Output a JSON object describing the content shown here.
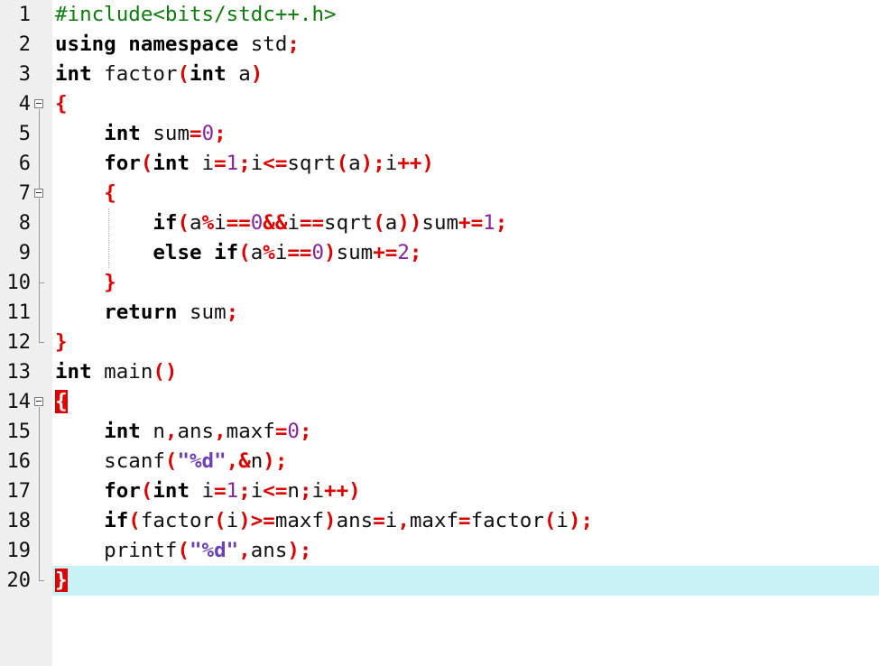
{
  "editor": {
    "current_line": 20,
    "lines": [
      {
        "n": "1"
      },
      {
        "n": "2"
      },
      {
        "n": "3"
      },
      {
        "n": "4"
      },
      {
        "n": "5"
      },
      {
        "n": "6"
      },
      {
        "n": "7"
      },
      {
        "n": "8"
      },
      {
        "n": "9"
      },
      {
        "n": "10"
      },
      {
        "n": "11"
      },
      {
        "n": "12"
      },
      {
        "n": "13"
      },
      {
        "n": "14"
      },
      {
        "n": "15"
      },
      {
        "n": "16"
      },
      {
        "n": "17"
      },
      {
        "n": "18"
      },
      {
        "n": "19"
      },
      {
        "n": "20"
      }
    ],
    "tokens": {
      "l1": {
        "a": "#include<bits/stdc++.h>"
      },
      "l2": {
        "a": "using",
        "b": " ",
        "c": "namespace",
        "d": " std",
        "e": ";"
      },
      "l3": {
        "a": "int",
        "b": " factor",
        "c": "(",
        "d": "int",
        "e": " a",
        "f": ")"
      },
      "l4": {
        "a": "{"
      },
      "l5": {
        "a": "    ",
        "b": "int",
        "c": " sum",
        "d": "=",
        "e": "0",
        "f": ";"
      },
      "l6": {
        "a": "    ",
        "b": "for",
        "c": "(",
        "d": "int",
        "e": " i",
        "f": "=",
        "g": "1",
        "h": ";",
        "i": "i",
        "j": "<=",
        "k": "sqrt",
        "l": "(",
        "m": "a",
        "n": ");",
        "o": "i",
        "p": "++",
        "q": ")"
      },
      "l7": {
        "a": "    ",
        "b": "{"
      },
      "l8": {
        "a": "        ",
        "b": "if",
        "c": "(",
        "d": "a",
        "e": "%",
        "f": "i",
        "g": "==",
        "h": "0",
        "i": "&&",
        "j": "i",
        "k": "==",
        "l": "sqrt",
        "m": "(",
        "n": "a",
        "o": "))",
        "p": "sum",
        "q": "+=",
        "r": "1",
        "s": ";"
      },
      "l9": {
        "a": "        ",
        "b": "else",
        "c": " ",
        "d": "if",
        "e": "(",
        "f": "a",
        "g": "%",
        "h": "i",
        "i": "==",
        "j": "0",
        "k": ")",
        "l": "sum",
        "m": "+=",
        "n": "2",
        "o": ";"
      },
      "l10": {
        "a": "    ",
        "b": "}"
      },
      "l11": {
        "a": "    ",
        "b": "return",
        "c": " sum",
        "d": ";"
      },
      "l12": {
        "a": "}"
      },
      "l13": {
        "a": "int",
        "b": " main",
        "c": "()"
      },
      "l14": {
        "a": "{"
      },
      "l15": {
        "a": "    ",
        "b": "int",
        "c": " n",
        "d": ",",
        "e": "ans",
        "f": ",",
        "g": "maxf",
        "h": "=",
        "i": "0",
        "j": ";"
      },
      "l16": {
        "a": "    scanf",
        "b": "(",
        "c": "\"%d\"",
        "d": ",",
        "e": "&",
        "f": "n",
        "g": ");"
      },
      "l17": {
        "a": "    ",
        "b": "for",
        "c": "(",
        "d": "int",
        "e": " i",
        "f": "=",
        "g": "1",
        "h": ";",
        "i": "i",
        "j": "<=",
        "k": "n",
        "l": ";",
        "m": "i",
        "n": "++",
        "o": ")"
      },
      "l18": {
        "a": "    ",
        "b": "if",
        "c": "(",
        "d": "factor",
        "e": "(",
        "f": "i",
        "g": ")>=",
        "h": "maxf",
        "i": ")",
        "j": "ans",
        "k": "=",
        "l": "i",
        "m": ",",
        "n": "maxf",
        "o": "=",
        "p": "factor",
        "q": "(",
        "r": "i",
        "s": ");"
      },
      "l19": {
        "a": "    printf",
        "b": "(",
        "c": "\"%d\"",
        "d": ",",
        "e": "ans",
        "f": ");"
      },
      "l20": {
        "a": "}"
      }
    }
  },
  "colors": {
    "keyword": "#000000",
    "preprocessor": "#0a7d0a",
    "operator": "#e00000",
    "number": "#8a22a6",
    "string": "#6b3fb8",
    "current_line_bg": "#c8f2f6",
    "gutter_bg": "#efefef"
  }
}
